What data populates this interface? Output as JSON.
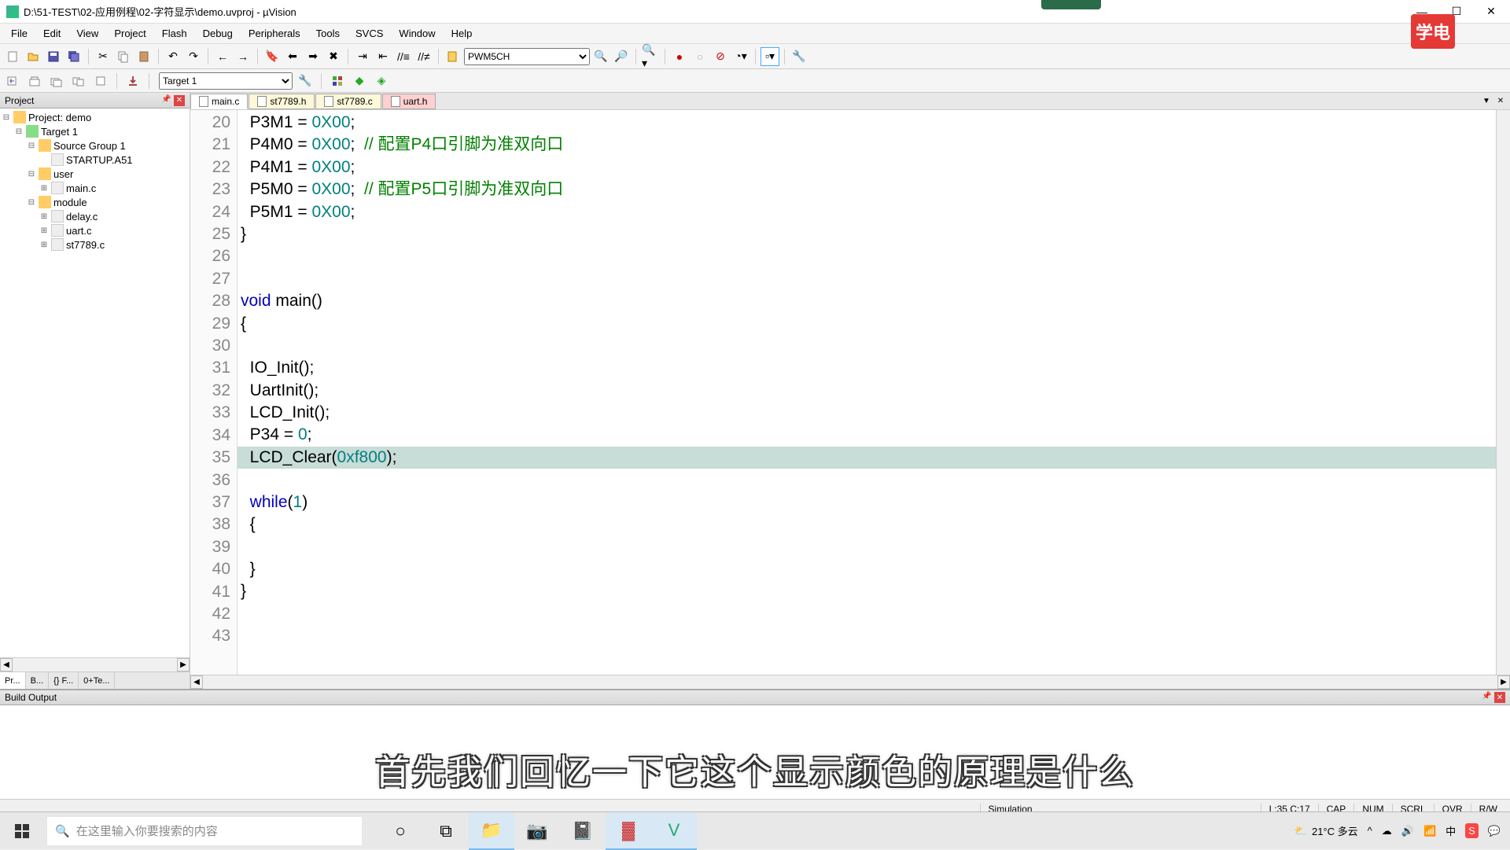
{
  "window": {
    "title": "D:\\51-TEST\\02-应用例程\\02-字符显示\\demo.uvproj - µVision"
  },
  "menus": [
    "File",
    "Edit",
    "View",
    "Project",
    "Flash",
    "Debug",
    "Peripherals",
    "Tools",
    "SVCS",
    "Window",
    "Help"
  ],
  "toolbar1": {
    "pwm": "PWM5CH"
  },
  "toolbar2": {
    "target": "Target 1"
  },
  "project": {
    "title": "Project",
    "root": "Project: demo",
    "target": "Target 1",
    "groups": [
      {
        "name": "Source Group 1",
        "files": [
          "STARTUP.A51"
        ]
      },
      {
        "name": "user",
        "files": [
          "main.c"
        ]
      },
      {
        "name": "module",
        "files": [
          "delay.c",
          "uart.c",
          "st7789.c"
        ]
      }
    ],
    "tabs": [
      "Pr...",
      "B...",
      "{} F...",
      "0+Te..."
    ]
  },
  "editor": {
    "tabs": [
      {
        "name": "main.c",
        "active": true,
        "mod": false
      },
      {
        "name": "st7789.h",
        "active": false,
        "mod": false
      },
      {
        "name": "st7789.c",
        "active": false,
        "mod": false
      },
      {
        "name": "uart.h",
        "active": false,
        "mod": true
      }
    ],
    "firstLine": 20,
    "highlightLine": 35,
    "lines": [
      {
        "raw": "  P3M1 = 0X00;",
        "segs": [
          [
            "  P3M1 = ",
            ""
          ],
          [
            "0X00",
            "num"
          ],
          [
            ";",
            ""
          ]
        ]
      },
      {
        "raw": "  P4M0 = 0X00;  // 配置P4口引脚为准双向口",
        "segs": [
          [
            "  P4M0 = ",
            ""
          ],
          [
            "0X00",
            "num"
          ],
          [
            ";  ",
            ""
          ],
          [
            "// 配置P4口引脚为准双向口",
            "cm"
          ]
        ]
      },
      {
        "raw": "  P4M1 = 0X00;",
        "segs": [
          [
            "  P4M1 = ",
            ""
          ],
          [
            "0X00",
            "num"
          ],
          [
            ";",
            ""
          ]
        ]
      },
      {
        "raw": "  P5M0 = 0X00;  // 配置P5口引脚为准双向口",
        "segs": [
          [
            "  P5M0 = ",
            ""
          ],
          [
            "0X00",
            "num"
          ],
          [
            ";  ",
            ""
          ],
          [
            "// 配置P5口引脚为准双向口",
            "cm"
          ]
        ]
      },
      {
        "raw": "  P5M1 = 0X00;",
        "segs": [
          [
            "  P5M1 = ",
            ""
          ],
          [
            "0X00",
            "num"
          ],
          [
            ";",
            ""
          ]
        ]
      },
      {
        "raw": "}",
        "segs": [
          [
            "}",
            ""
          ]
        ]
      },
      {
        "raw": "",
        "segs": []
      },
      {
        "raw": "",
        "segs": []
      },
      {
        "raw": "void main()",
        "segs": [
          [
            "void",
            "kw"
          ],
          [
            " main()",
            ""
          ]
        ]
      },
      {
        "raw": "{",
        "segs": [
          [
            "{",
            ""
          ]
        ]
      },
      {
        "raw": "",
        "segs": []
      },
      {
        "raw": "  IO_Init();",
        "segs": [
          [
            "  IO_Init();",
            ""
          ]
        ]
      },
      {
        "raw": "  UartInit();",
        "segs": [
          [
            "  UartInit();",
            ""
          ]
        ]
      },
      {
        "raw": "  LCD_Init();",
        "segs": [
          [
            "  LCD_Init();",
            ""
          ]
        ]
      },
      {
        "raw": "  P34 = 0;",
        "segs": [
          [
            "  P34 = ",
            ""
          ],
          [
            "0",
            "num"
          ],
          [
            ";",
            ""
          ]
        ]
      },
      {
        "raw": "  LCD_Clear(0xf800);",
        "segs": [
          [
            "  LCD_Clear(",
            ""
          ],
          [
            "0xf800",
            "num"
          ],
          [
            ");",
            ""
          ]
        ]
      },
      {
        "raw": "",
        "segs": []
      },
      {
        "raw": "  while(1)",
        "segs": [
          [
            "  ",
            ""
          ],
          [
            "while",
            "kw"
          ],
          [
            "(",
            ""
          ],
          [
            "1",
            "num"
          ],
          [
            ")",
            ""
          ]
        ]
      },
      {
        "raw": "  {",
        "segs": [
          [
            "  {",
            ""
          ]
        ]
      },
      {
        "raw": "",
        "segs": []
      },
      {
        "raw": "  }",
        "segs": [
          [
            "  }",
            ""
          ]
        ]
      },
      {
        "raw": "}",
        "segs": [
          [
            "}",
            ""
          ]
        ]
      },
      {
        "raw": "",
        "segs": []
      },
      {
        "raw": "",
        "segs": []
      }
    ]
  },
  "buildOutput": {
    "title": "Build Output"
  },
  "status": {
    "sim": "Simulation",
    "pos": "L:35 C:17",
    "caps": "CAP",
    "num": "NUM",
    "scrl": "SCRL",
    "ovr": "OVR",
    "rw": "R/W"
  },
  "taskbar": {
    "searchPlaceholder": "在这里输入你要搜索的内容",
    "weather": "21°C 多云",
    "time": ""
  },
  "overlay": {
    "subtitle": "首先我们回忆一下它这个显示颜色的原理是什么",
    "logo": "学电"
  }
}
